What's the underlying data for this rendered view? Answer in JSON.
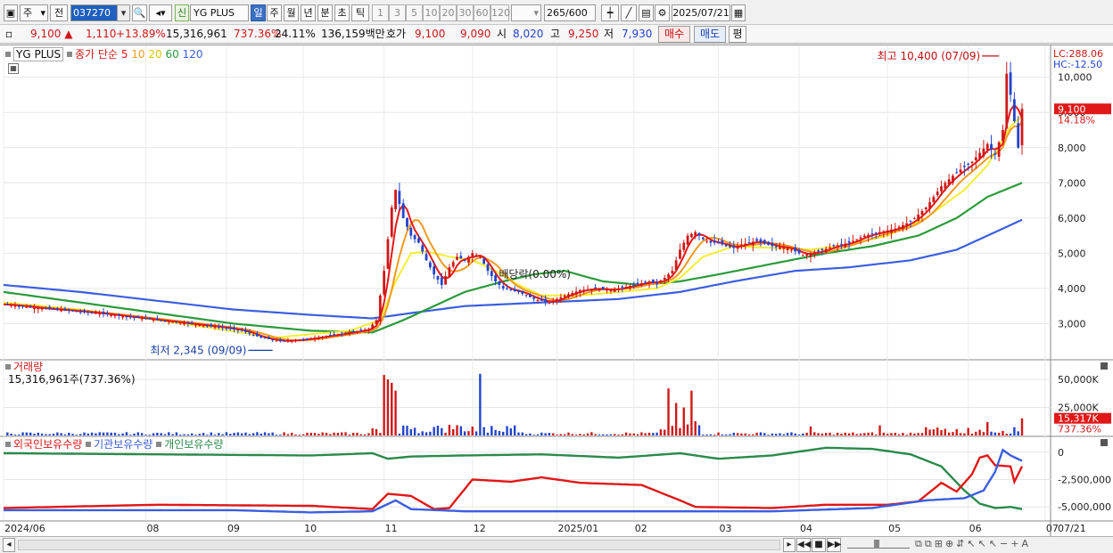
{
  "toolbar": {
    "market": "주",
    "prefix": "전",
    "code": "037270",
    "name": "YG PLUS",
    "period_badge": "신",
    "periods": [
      "일",
      "주",
      "월",
      "년",
      "분",
      "초",
      "틱"
    ],
    "intervals": [
      "1",
      "3",
      "5",
      "10",
      "20",
      "30",
      "60",
      "120"
    ],
    "count": "265",
    "count_max": "/600",
    "date": "2025/07/21"
  },
  "info": {
    "price": "9,100",
    "change": "1,110",
    "pct": "+13.89%",
    "volume": "15,316,961",
    "vol_ratio": "737.36%",
    "turnover": "24.11%",
    "amount": "136,159백만",
    "quote_label": "호가",
    "ask": "9,100",
    "bid": "9,090",
    "open_label": "시",
    "open": "8,020",
    "high_label": "고",
    "high": "9,250",
    "low_label": "저",
    "low": "7,930",
    "buy_label": "매수",
    "sell_label": "매도",
    "avg_label": "평"
  },
  "legend": {
    "name": "YG PLUS",
    "ma_label": "종가 단순",
    "ma": [
      "5",
      "10",
      "20",
      "60",
      "120"
    ]
  },
  "annotations": {
    "max": "최고 10,400 (07/09)",
    "min": "최저 2,345 (09/09)",
    "dividend": "배당락(0.00%)"
  },
  "price_axis": {
    "lc": "LC:288.06",
    "hc": "HC:-12.50",
    "ticks": [
      "10,000",
      "9,000",
      "8,000",
      "7,000",
      "6,000",
      "5,000",
      "4,000",
      "3,000"
    ],
    "last": "9,100",
    "last_pct": "14.18%"
  },
  "volume_panel": {
    "title": "거래량",
    "value": "15,316,961주(737.36%)",
    "ticks": [
      "50,000K",
      "25,000K"
    ],
    "last": "15,317K",
    "last_pct": "737.36%"
  },
  "holding_panel": {
    "series": [
      "외국인보유수량",
      "기관보유수량",
      "개인보유수량"
    ],
    "ticks": [
      "0",
      "-2,500,000",
      "-5,000,000"
    ]
  },
  "x_labels": [
    "2024/06",
    "08",
    "09",
    "10",
    "11",
    "12",
    "2025/01",
    "02",
    "03",
    "04",
    "05",
    "06",
    "07",
    "07/21"
  ],
  "colors": {
    "up": "#d01818",
    "down": "#2244cc",
    "ma5": "#e81818",
    "ma10": "#f09a20",
    "ma20": "#f4ee30",
    "ma60": "#2a9a3a",
    "ma120": "#3a5ee0",
    "foreign": "#e01818",
    "inst": "#3a5ee0",
    "indiv": "#2a8a4a"
  },
  "chart_data": {
    "type": "candlestick",
    "title": "YG PLUS",
    "x_range": [
      "2024/06",
      "2025/07/21"
    ],
    "y_range": [
      2000,
      10700
    ],
    "close_path": [
      [
        0,
        3550
      ],
      [
        8,
        3450
      ],
      [
        16,
        3380
      ],
      [
        24,
        3300
      ],
      [
        32,
        3200
      ],
      [
        40,
        3100
      ],
      [
        48,
        3000
      ],
      [
        56,
        2900
      ],
      [
        62,
        2800
      ],
      [
        67,
        2600
      ],
      [
        72,
        2500
      ],
      [
        78,
        2550
      ],
      [
        84,
        2650
      ],
      [
        90,
        2750
      ],
      [
        95,
        2850
      ],
      [
        97,
        3100
      ],
      [
        99,
        4500
      ],
      [
        101,
        6300
      ],
      [
        102,
        6800
      ],
      [
        104,
        6000
      ],
      [
        106,
        5500
      ],
      [
        108,
        5300
      ],
      [
        110,
        4800
      ],
      [
        112,
        4400
      ],
      [
        114,
        4100
      ],
      [
        116,
        4600
      ],
      [
        118,
        4900
      ],
      [
        120,
        4800
      ],
      [
        122,
        5000
      ],
      [
        124,
        4900
      ],
      [
        126,
        4500
      ],
      [
        128,
        4200
      ],
      [
        130,
        4000
      ],
      [
        134,
        3900
      ],
      [
        138,
        3700
      ],
      [
        142,
        3600
      ],
      [
        146,
        3800
      ],
      [
        150,
        3950
      ],
      [
        154,
        4000
      ],
      [
        158,
        3950
      ],
      [
        162,
        4050
      ],
      [
        166,
        4150
      ],
      [
        168,
        4200
      ],
      [
        170,
        4150
      ],
      [
        172,
        4300
      ],
      [
        174,
        4500
      ],
      [
        176,
        5100
      ],
      [
        178,
        5500
      ],
      [
        180,
        5600
      ],
      [
        182,
        5400
      ],
      [
        184,
        5300
      ],
      [
        186,
        5300
      ],
      [
        188,
        5200
      ],
      [
        190,
        5150
      ],
      [
        192,
        5250
      ],
      [
        196,
        5350
      ],
      [
        200,
        5200
      ],
      [
        204,
        5150
      ],
      [
        208,
        4950
      ],
      [
        212,
        5050
      ],
      [
        216,
        5200
      ],
      [
        220,
        5300
      ],
      [
        224,
        5500
      ],
      [
        228,
        5600
      ],
      [
        232,
        5700
      ],
      [
        236,
        5900
      ],
      [
        240,
        6300
      ],
      [
        244,
        6900
      ],
      [
        248,
        7300
      ],
      [
        252,
        7600
      ],
      [
        256,
        8100
      ],
      [
        258,
        7800
      ],
      [
        260,
        8500
      ],
      [
        261,
        10100
      ],
      [
        262,
        9500
      ],
      [
        264,
        8000
      ],
      [
        265,
        9100
      ]
    ],
    "ma20_path": [
      [
        0,
        3600
      ],
      [
        20,
        3400
      ],
      [
        40,
        3100
      ],
      [
        56,
        2850
      ],
      [
        70,
        2600
      ],
      [
        90,
        2800
      ],
      [
        98,
        3100
      ],
      [
        102,
        4200
      ],
      [
        106,
        5000
      ],
      [
        110,
        5050
      ],
      [
        116,
        4900
      ],
      [
        122,
        4800
      ],
      [
        128,
        4500
      ],
      [
        134,
        4100
      ],
      [
        140,
        3800
      ],
      [
        150,
        3800
      ],
      [
        160,
        3900
      ],
      [
        170,
        4000
      ],
      [
        176,
        4300
      ],
      [
        182,
        4900
      ],
      [
        190,
        5200
      ],
      [
        200,
        5150
      ],
      [
        210,
        5100
      ],
      [
        220,
        5250
      ],
      [
        230,
        5500
      ],
      [
        240,
        6000
      ],
      [
        250,
        6800
      ],
      [
        256,
        7500
      ],
      [
        262,
        8600
      ],
      [
        265,
        8900
      ]
    ],
    "ma60_path": [
      [
        0,
        3900
      ],
      [
        20,
        3600
      ],
      [
        40,
        3300
      ],
      [
        60,
        3000
      ],
      [
        80,
        2800
      ],
      [
        96,
        2750
      ],
      [
        104,
        3100
      ],
      [
        112,
        3500
      ],
      [
        120,
        3900
      ],
      [
        130,
        4200
      ],
      [
        138,
        4400
      ],
      [
        146,
        4500
      ],
      [
        156,
        4200
      ],
      [
        166,
        4100
      ],
      [
        176,
        4200
      ],
      [
        186,
        4400
      ],
      [
        200,
        4700
      ],
      [
        214,
        5000
      ],
      [
        226,
        5200
      ],
      [
        238,
        5500
      ],
      [
        248,
        6000
      ],
      [
        256,
        6600
      ],
      [
        265,
        7000
      ]
    ],
    "ma120_path": [
      [
        0,
        4100
      ],
      [
        20,
        3900
      ],
      [
        40,
        3650
      ],
      [
        60,
        3400
      ],
      [
        80,
        3250
      ],
      [
        96,
        3150
      ],
      [
        106,
        3300
      ],
      [
        120,
        3500
      ],
      [
        140,
        3600
      ],
      [
        160,
        3700
      ],
      [
        176,
        3900
      ],
      [
        190,
        4200
      ],
      [
        206,
        4500
      ],
      [
        220,
        4600
      ],
      [
        236,
        4800
      ],
      [
        248,
        5100
      ],
      [
        258,
        5600
      ],
      [
        265,
        5950
      ]
    ],
    "volume_spikes_k": [
      [
        99,
        54000
      ],
      [
        100,
        50000
      ],
      [
        101,
        47000
      ],
      [
        102,
        40000
      ],
      [
        124,
        55000
      ],
      [
        173,
        42000
      ],
      [
        175,
        29000
      ],
      [
        177,
        25000
      ],
      [
        179,
        40000
      ],
      [
        210,
        8000
      ],
      [
        228,
        9000
      ],
      [
        256,
        12000
      ],
      [
        265,
        15317
      ]
    ],
    "holdings": {
      "foreign_path": [
        [
          0,
          -5100
        ],
        [
          40,
          -4800
        ],
        [
          80,
          -4900
        ],
        [
          96,
          -5200
        ],
        [
          100,
          -3800
        ],
        [
          106,
          -4000
        ],
        [
          112,
          -5200
        ],
        [
          116,
          -5100
        ],
        [
          122,
          -2500
        ],
        [
          132,
          -2700
        ],
        [
          140,
          -2300
        ],
        [
          150,
          -2800
        ],
        [
          166,
          -3000
        ],
        [
          176,
          -4400
        ],
        [
          180,
          -5000
        ],
        [
          200,
          -5100
        ],
        [
          214,
          -4800
        ],
        [
          230,
          -4800
        ],
        [
          238,
          -4500
        ],
        [
          244,
          -2800
        ],
        [
          248,
          -3600
        ],
        [
          252,
          -2000
        ],
        [
          254,
          -500
        ],
        [
          256,
          -300
        ],
        [
          258,
          -1200
        ],
        [
          262,
          -1300
        ],
        [
          263,
          -2700
        ],
        [
          265,
          -1300
        ]
      ],
      "inst_path": [
        [
          0,
          -5300
        ],
        [
          60,
          -5300
        ],
        [
          80,
          -5500
        ],
        [
          96,
          -5400
        ],
        [
          102,
          -4400
        ],
        [
          106,
          -5200
        ],
        [
          120,
          -5400
        ],
        [
          160,
          -5400
        ],
        [
          200,
          -5400
        ],
        [
          226,
          -5100
        ],
        [
          240,
          -4400
        ],
        [
          250,
          -4200
        ],
        [
          255,
          -3500
        ],
        [
          258,
          -1800
        ],
        [
          260,
          200
        ],
        [
          262,
          -300
        ],
        [
          265,
          -800
        ]
      ],
      "indiv_path": [
        [
          0,
          -100
        ],
        [
          40,
          -200
        ],
        [
          80,
          -300
        ],
        [
          96,
          -100
        ],
        [
          100,
          -600
        ],
        [
          106,
          -400
        ],
        [
          120,
          -300
        ],
        [
          140,
          -200
        ],
        [
          160,
          -500
        ],
        [
          176,
          -100
        ],
        [
          186,
          -600
        ],
        [
          200,
          -300
        ],
        [
          214,
          400
        ],
        [
          226,
          300
        ],
        [
          236,
          -200
        ],
        [
          244,
          -1300
        ],
        [
          250,
          -3500
        ],
        [
          254,
          -4700
        ],
        [
          258,
          -5100
        ],
        [
          262,
          -5000
        ],
        [
          265,
          -5200
        ]
      ]
    }
  }
}
